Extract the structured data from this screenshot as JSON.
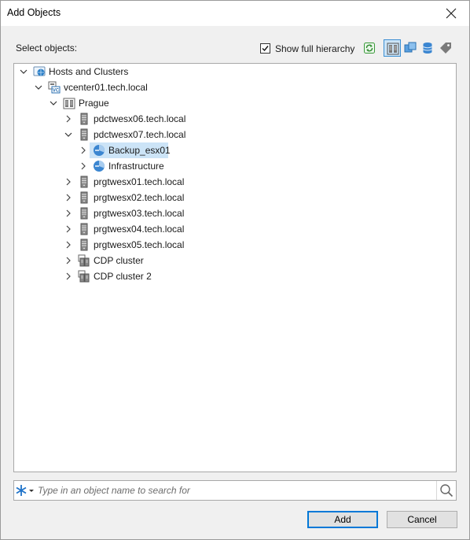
{
  "window": {
    "title": "Add Objects"
  },
  "toolbar": {
    "select_label": "Select objects:",
    "show_full_hierarchy_label": "Show full hierarchy",
    "show_full_hierarchy_checked": true,
    "buttons": [
      {
        "name": "refresh-icon"
      },
      {
        "name": "hosts-and-clusters-view-icon",
        "active": true
      },
      {
        "name": "vms-and-templates-view-icon"
      },
      {
        "name": "datastores-view-icon"
      },
      {
        "name": "tags-view-icon"
      }
    ]
  },
  "tree": {
    "nodes": [
      {
        "label": "Hosts and Clusters",
        "icon": "hosts-clusters-icon",
        "depth": 0,
        "expander": "expanded"
      },
      {
        "label": "vcenter01.tech.local",
        "icon": "vcenter-icon",
        "depth": 1,
        "expander": "expanded"
      },
      {
        "label": "Prague",
        "icon": "datacenter-icon",
        "depth": 2,
        "expander": "expanded"
      },
      {
        "label": "pdctwesx06.tech.local",
        "icon": "host-icon",
        "depth": 3,
        "expander": "collapsed"
      },
      {
        "label": "pdctwesx07.tech.local",
        "icon": "host-icon",
        "depth": 3,
        "expander": "expanded"
      },
      {
        "label": "Backup_esx01",
        "icon": "resource-pool-icon",
        "depth": 4,
        "expander": "collapsed",
        "selected": true
      },
      {
        "label": "Infrastructure",
        "icon": "resource-pool-icon",
        "depth": 4,
        "expander": "collapsed"
      },
      {
        "label": "prgtwesx01.tech.local",
        "icon": "host-icon",
        "depth": 3,
        "expander": "collapsed"
      },
      {
        "label": "prgtwesx02.tech.local",
        "icon": "host-icon",
        "depth": 3,
        "expander": "collapsed"
      },
      {
        "label": "prgtwesx03.tech.local",
        "icon": "host-icon",
        "depth": 3,
        "expander": "collapsed"
      },
      {
        "label": "prgtwesx04.tech.local",
        "icon": "host-icon",
        "depth": 3,
        "expander": "collapsed"
      },
      {
        "label": "prgtwesx05.tech.local",
        "icon": "host-icon",
        "depth": 3,
        "expander": "collapsed"
      },
      {
        "label": "CDP cluster",
        "icon": "cluster-icon",
        "depth": 3,
        "expander": "collapsed"
      },
      {
        "label": "CDP cluster 2",
        "icon": "cluster-icon",
        "depth": 3,
        "expander": "collapsed"
      }
    ]
  },
  "search": {
    "placeholder": "Type in an object name to search for",
    "value": ""
  },
  "footer": {
    "add_label": "Add",
    "cancel_label": "Cancel"
  },
  "colors": {
    "selection": "#cce4f7",
    "accent": "#0078d7",
    "icon_blue": "#2a7fc8"
  }
}
